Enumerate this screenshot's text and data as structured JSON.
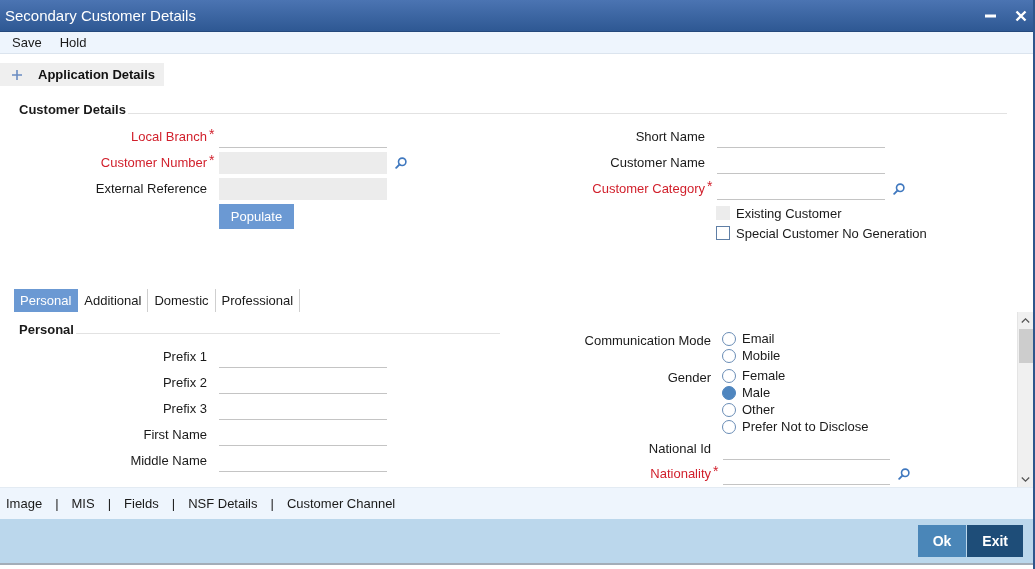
{
  "window": {
    "title": "Secondary Customer Details"
  },
  "menu": [
    {
      "label": "Save"
    },
    {
      "label": "Hold"
    }
  ],
  "application_details": {
    "label": "Application Details",
    "expanded": false
  },
  "required_mark": "*",
  "customer_details": {
    "heading": "Customer Details",
    "left_fields": [
      {
        "label": "Local Branch",
        "required": true,
        "disabled": false,
        "lookup": false
      },
      {
        "label": "Customer Number",
        "required": true,
        "disabled": true,
        "lookup": true
      },
      {
        "label": "External Reference",
        "required": false,
        "disabled": true,
        "lookup": false
      }
    ],
    "populate_button": "Populate",
    "right_fields": [
      {
        "label": "Short Name",
        "required": false,
        "disabled": false,
        "lookup": false
      },
      {
        "label": "Customer Name",
        "required": false,
        "disabled": false,
        "lookup": false
      },
      {
        "label": "Customer Category",
        "required": true,
        "disabled": false,
        "lookup": true
      }
    ],
    "checkboxes": [
      {
        "label": "Existing Customer",
        "checked": false,
        "disabled": true
      },
      {
        "label": "Special Customer No Generation",
        "checked": false,
        "disabled": false
      }
    ]
  },
  "tabs": [
    {
      "label": "Personal",
      "selected": true
    },
    {
      "label": "Additional",
      "selected": false
    },
    {
      "label": "Domestic",
      "selected": false
    },
    {
      "label": "Professional",
      "selected": false
    }
  ],
  "personal": {
    "heading": "Personal",
    "fields": [
      {
        "label": "Prefix 1"
      },
      {
        "label": "Prefix 2"
      },
      {
        "label": "Prefix 3"
      },
      {
        "label": "First Name"
      },
      {
        "label": "Middle Name"
      }
    ],
    "radio_groups": [
      {
        "label": "Communication Mode",
        "options": [
          {
            "label": "Email",
            "selected": false
          },
          {
            "label": "Mobile",
            "selected": false
          }
        ]
      },
      {
        "label": "Gender",
        "options": [
          {
            "label": "Female",
            "selected": false
          },
          {
            "label": "Male",
            "selected": true
          },
          {
            "label": "Other",
            "selected": false
          },
          {
            "label": "Prefer Not to Disclose",
            "selected": false
          }
        ]
      }
    ],
    "right_fields": [
      {
        "label": "National Id",
        "required": false,
        "lookup": false
      },
      {
        "label": "Nationality",
        "required": true,
        "lookup": true
      }
    ]
  },
  "footer_links": {
    "separator": "|",
    "items": [
      "Image",
      "MIS",
      "Fields",
      "NSF Details",
      "Customer Channel"
    ]
  },
  "buttons": [
    {
      "label": "Ok",
      "kind": "secondary"
    },
    {
      "label": "Exit",
      "kind": "primary"
    }
  ]
}
